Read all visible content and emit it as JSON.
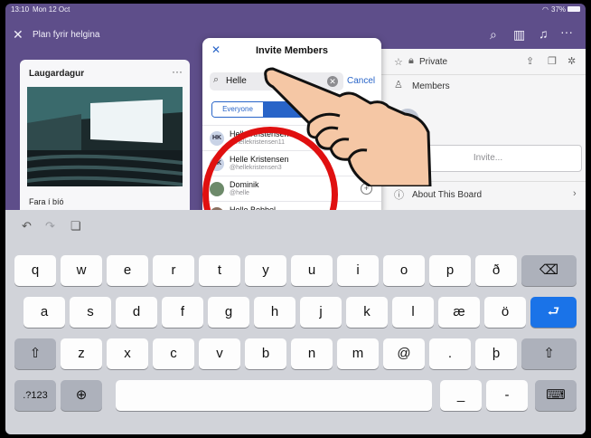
{
  "status": {
    "time": "13:10",
    "date": "Mon 12 Oct",
    "battery": "37%"
  },
  "topbar": {
    "close_icon": "close-icon",
    "board_title": "Plan fyrir helgina"
  },
  "board": {
    "list_title": "Laugardagur",
    "card_title": "Fara í bíó",
    "more_label": "···"
  },
  "right_panel": {
    "privacy_label": "Private",
    "members_label": "Members",
    "invite_button": "Invite...",
    "about_label": "About This Board"
  },
  "dialog": {
    "title": "Invite Members",
    "search_value": "Helle",
    "cancel_label": "Cancel",
    "segments": [
      "Everyone",
      "Te"
    ],
    "members": [
      {
        "initials": "HK",
        "name": "Helle Kristensen",
        "handle": "@hellekristensen11"
      },
      {
        "initials": "HK",
        "name": "Helle Kristensen",
        "handle": "@hellekristensen3"
      },
      {
        "initials": "",
        "name": "Dominik",
        "handle": "@helle"
      },
      {
        "initials": "",
        "name": "Helle Bobbel",
        "handle": ""
      }
    ]
  },
  "keyboard": {
    "row1": [
      "q",
      "w",
      "e",
      "r",
      "t",
      "y",
      "u",
      "i",
      "o",
      "p",
      "ð"
    ],
    "row2": [
      "a",
      "s",
      "d",
      "f",
      "g",
      "h",
      "j",
      "k",
      "l",
      "æ",
      "ö"
    ],
    "row3": [
      "z",
      "x",
      "c",
      "v",
      "b",
      "n",
      "m",
      "@",
      ".",
      "þ"
    ],
    "numbers_label": ".?123",
    "dash_keys": [
      "_",
      "-"
    ]
  },
  "colors": {
    "accent": "#2864c8",
    "board_bg": "#5e4e8a",
    "annotation": "#e01010",
    "return_key": "#1a73e8"
  }
}
